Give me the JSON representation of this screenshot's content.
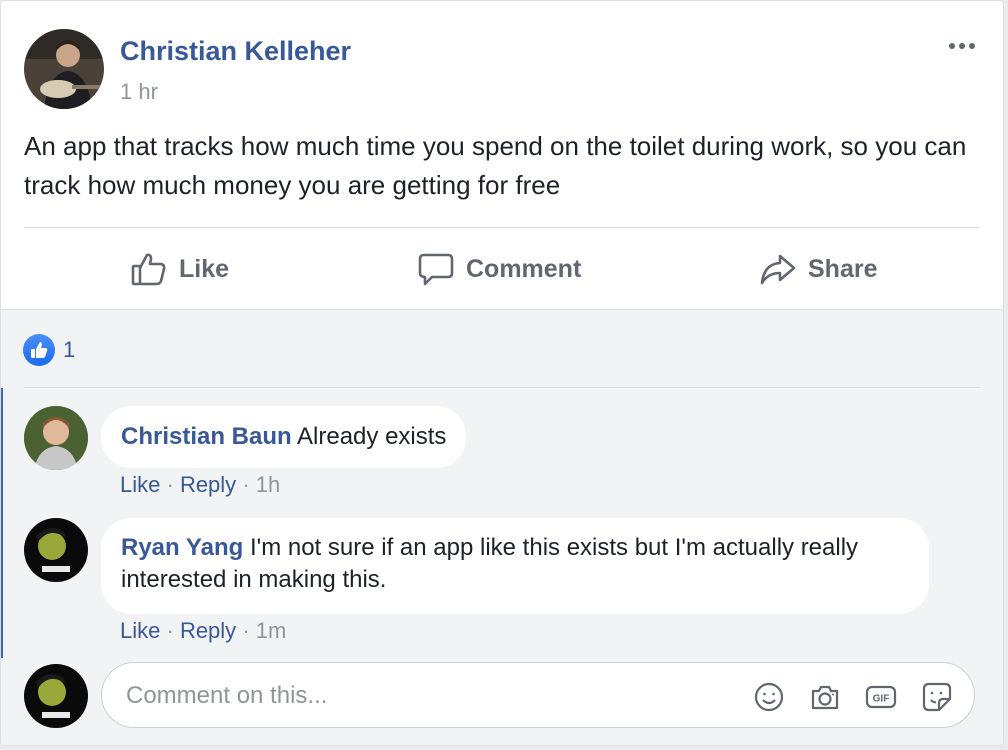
{
  "post": {
    "author": "Christian Kelleher",
    "time": "1 hr",
    "text": "An app that tracks how much time you spend on the toilet during work, so you can track how much money you are getting for free"
  },
  "actions": {
    "like": "Like",
    "comment": "Comment",
    "share": "Share"
  },
  "reactions": {
    "count": "1",
    "icon": "like-icon"
  },
  "comments": [
    {
      "author": "Christian Baun",
      "text": "Already exists",
      "like": "Like",
      "reply": "Reply",
      "time": "1h"
    },
    {
      "author": "Ryan Yang",
      "text": "I'm not sure if an app like this exists but I'm actually really interested in making this.",
      "like": "Like",
      "reply": "Reply",
      "time": "1m"
    }
  ],
  "composer": {
    "placeholder": "Comment on this...",
    "icons": [
      "emoji-icon",
      "camera-icon",
      "gif-icon",
      "sticker-icon"
    ]
  },
  "colors": {
    "link": "#385898",
    "accent": "#4267b2",
    "muted": "#90949c"
  }
}
